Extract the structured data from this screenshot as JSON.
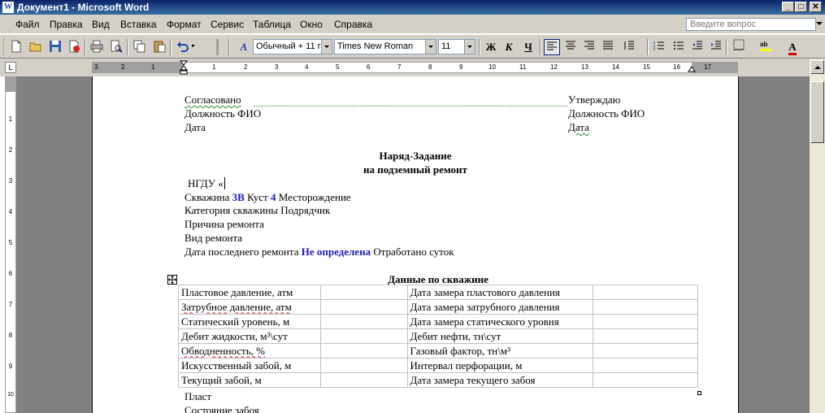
{
  "window": {
    "title": "Документ1 - Microsoft Word",
    "app_icon": "W"
  },
  "menu": {
    "items": [
      "Файл",
      "Правка",
      "Вид",
      "Вставка",
      "Формат",
      "Сервис",
      "Таблица",
      "Окно",
      "Справка"
    ],
    "ask_placeholder": "Введите вопрос"
  },
  "toolbar": {
    "style": "Обычный + 11 г",
    "font": "Times New Roman",
    "size": "11",
    "style_icon": "styles-icon",
    "bold": "Ж",
    "italic": "К",
    "underline": "Ч",
    "font_color": "A"
  },
  "ruler": {
    "h_numbers": [
      "3",
      "2",
      "1",
      "1",
      "2",
      "3",
      "4",
      "5",
      "6",
      "7",
      "8",
      "9",
      "10",
      "11",
      "12",
      "13",
      "14",
      "15",
      "16",
      "17"
    ],
    "v_numbers": [
      "1",
      "2",
      "3",
      "4",
      "5",
      "6",
      "7",
      "8",
      "9",
      "10"
    ],
    "tab_selector": "L"
  },
  "doc": {
    "header_left": [
      "Согласовано",
      "Должность ФИО",
      "Дата"
    ],
    "header_right": [
      "Утверждаю",
      "Должность ФИО",
      "Дата"
    ],
    "title1": "Наряд-Задание",
    "title2": "на подземный ремонт",
    "ngdu": "НГДУ «",
    "well_label": "Скважина",
    "well_value": "3В",
    "cluster_label": "Куст",
    "cluster_value": "4",
    "field_label": "Месторождение",
    "category_line": "Категория скважины  Подрядчик",
    "reason_line": "Причина ремонта",
    "kind_line": "Вид ремонта",
    "last_repair_label": "Дата последнего ремонта",
    "last_repair_value": "Не определена",
    "worked_label": "Отработано суток",
    "table_title": "Данные по скважине",
    "table_rows": [
      {
        "left": "Пластовое давление, атм",
        "right": "Дата замера пластового давления"
      },
      {
        "left": "Затрубное давление, атм",
        "right": "Дата замера затрубного давления"
      },
      {
        "left": "Статический уровень, м",
        "right": "Дата замера статического уровня"
      },
      {
        "left": "Дебит жидкости, м³\\сут",
        "right": "Дебит нефти, тн\\сут"
      },
      {
        "left": "Обводненность, %",
        "right": "Газовый фактор, тн\\м³"
      },
      {
        "left": "Искусственный забой, м",
        "right": "Интервал перфорации,  м"
      },
      {
        "left": "Текущий забой, м",
        "right": "Дата замера текущего забоя"
      }
    ],
    "after_table": [
      "Пласт",
      "Состояние забоя"
    ]
  },
  "colors": {
    "title_bar": "#0a246a",
    "chrome": "#d4d0c8",
    "emphasis_blue": "#1a1ab4",
    "page_bg": "#808080"
  }
}
